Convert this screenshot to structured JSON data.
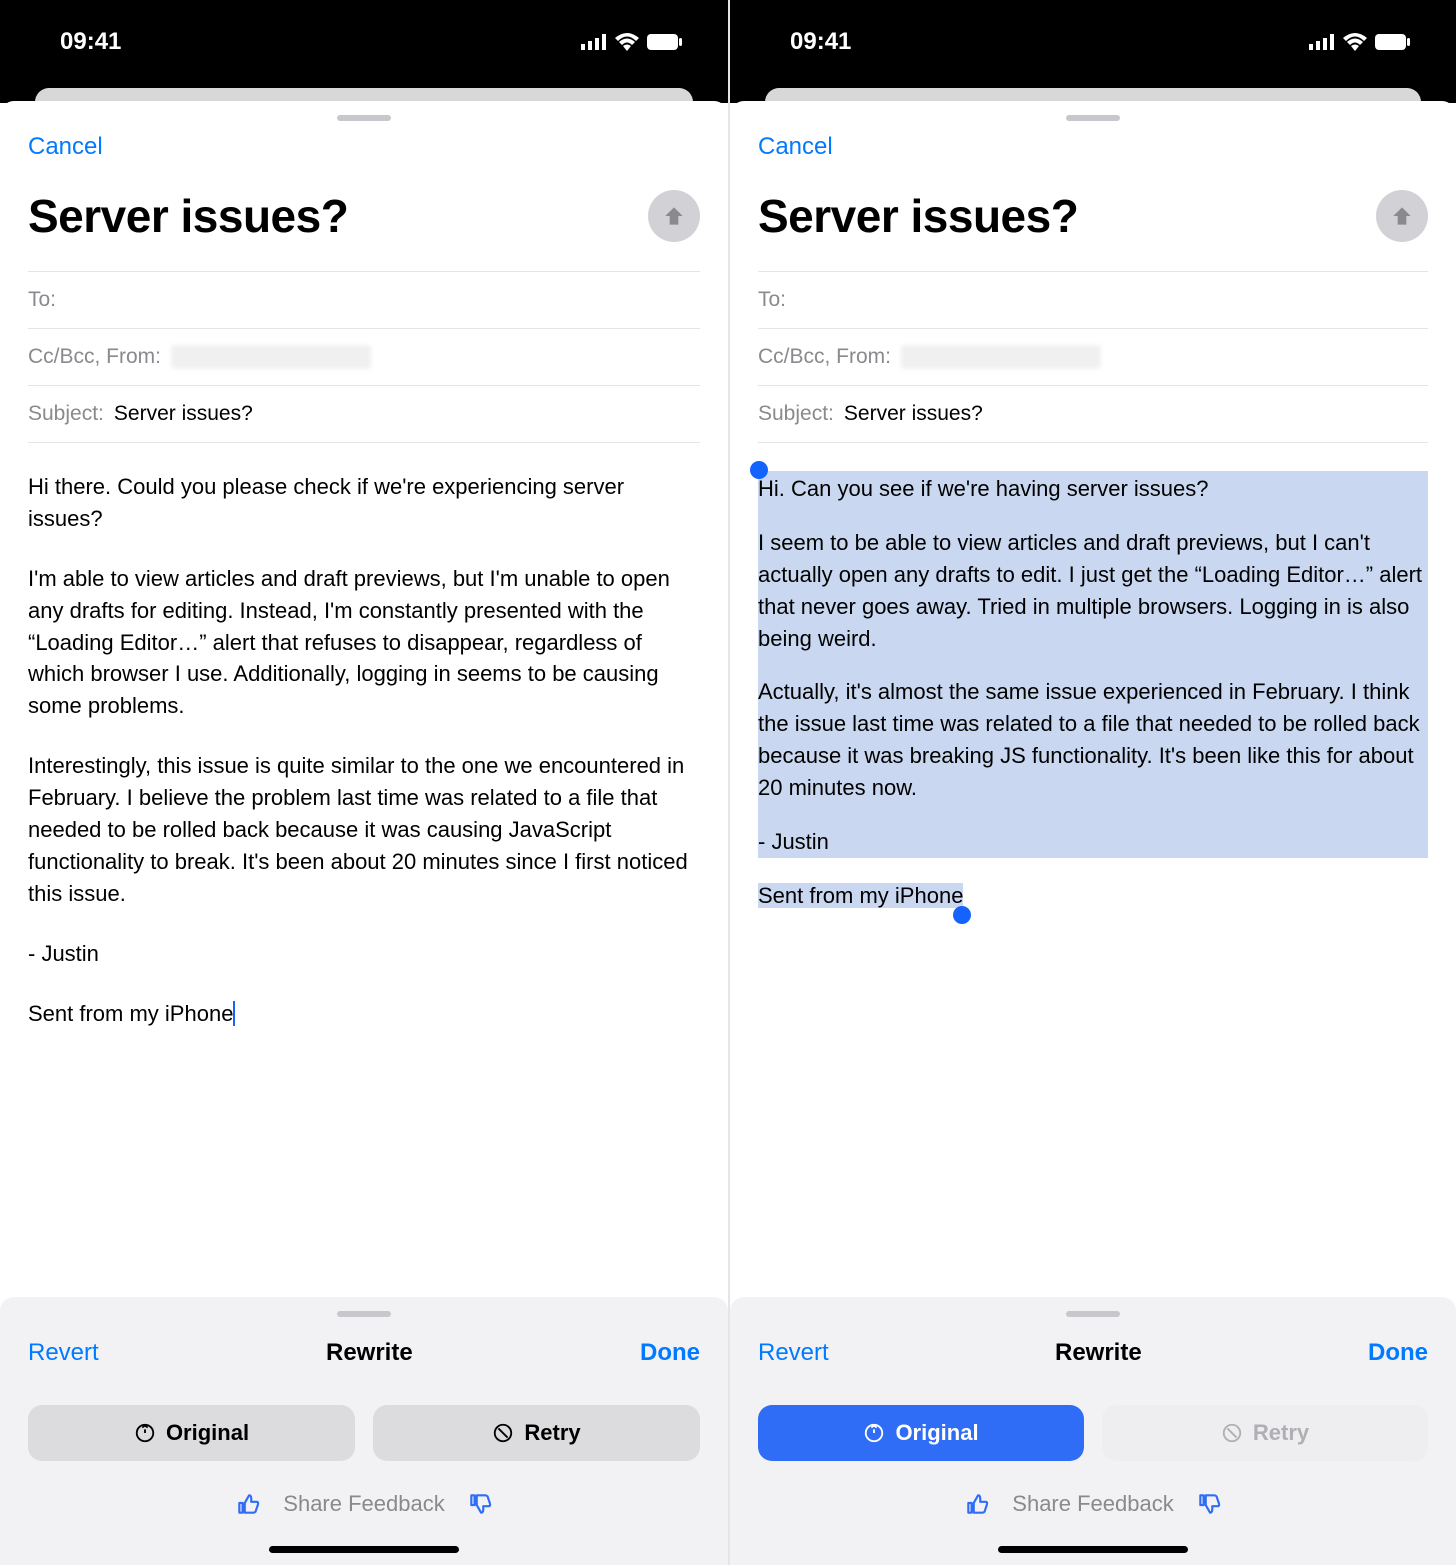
{
  "status": {
    "time": "09:41"
  },
  "left": {
    "cancel": "Cancel",
    "title": "Server issues?",
    "fields": {
      "to_label": "To:",
      "ccbcc_label": "Cc/Bcc, From:",
      "subject_label": "Subject:",
      "subject_value": "Server issues?"
    },
    "body": {
      "p1": "Hi there. Could you please check if we're experiencing server issues?",
      "p2": "I'm able to view articles and draft previews, but I'm unable to open any drafts for editing. Instead, I'm constantly presented with the “Loading Editor…” alert that refuses to disappear, regardless of which browser I use. Additionally, logging in seems to be causing some problems.",
      "p3": "Interestingly, this issue is quite similar to the one we encountered in February. I believe the problem last time was related to a file that needed to be rolled back because it was causing JavaScript functionality to break. It's been about 20 minutes since I first noticed this issue.",
      "sig": "- Justin",
      "sent": "Sent from my iPhone"
    },
    "toolbar": {
      "revert": "Revert",
      "title": "Rewrite",
      "done": "Done",
      "original": "Original",
      "retry": "Retry",
      "feedback": "Share Feedback"
    }
  },
  "right": {
    "cancel": "Cancel",
    "title": "Server issues?",
    "fields": {
      "to_label": "To:",
      "ccbcc_label": "Cc/Bcc, From:",
      "subject_label": "Subject:",
      "subject_value": "Server issues?"
    },
    "body": {
      "p1": "Hi. Can you see if we're having server issues?",
      "p2": "I seem to be able to view articles and draft previews, but I can't actually open any drafts to edit. I just get the “Loading Editor…” alert that never goes away. Tried in multiple browsers. Logging in is also being weird.",
      "p3": "Actually, it's almost the same issue experienced in February. I think the issue last time was related to a file that needed to be rolled back because it was breaking JS functionality. It's been like this for about 20 minutes now.",
      "sig": "- Justin",
      "sent": "Sent from my iPhone"
    },
    "toolbar": {
      "revert": "Revert",
      "title": "Rewrite",
      "done": "Done",
      "original": "Original",
      "retry": "Retry",
      "feedback": "Share Feedback"
    }
  }
}
